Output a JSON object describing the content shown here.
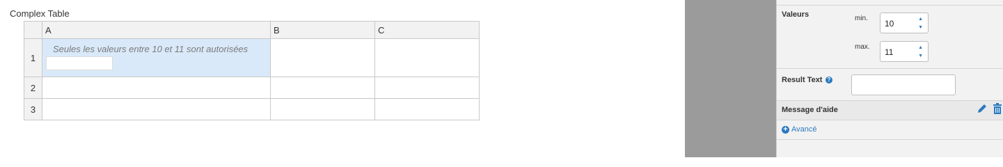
{
  "title": "Complex Table",
  "table": {
    "columns": [
      "A",
      "B",
      "C"
    ],
    "rows": [
      "1",
      "2",
      "3"
    ],
    "cell_A1_hint": "Seules les valeurs entre 10 et 11 sont autorisées"
  },
  "panel": {
    "valeurs_label": "Valeurs",
    "min_label": "min.",
    "min_value": "10",
    "max_label": "max.",
    "max_value": "11",
    "result_text_label": "Result Text",
    "message_label": "Message d'aide",
    "advanced_label": "Avancé"
  },
  "icons": {
    "help": "question-circle-icon",
    "edit": "pencil-icon",
    "delete": "trash-icon",
    "advanced": "plus-circle-icon"
  },
  "colors": {
    "accent": "#2a7ac0",
    "selected_cell": "#d9e9f9",
    "gray_panel": "#9b9b9b"
  }
}
